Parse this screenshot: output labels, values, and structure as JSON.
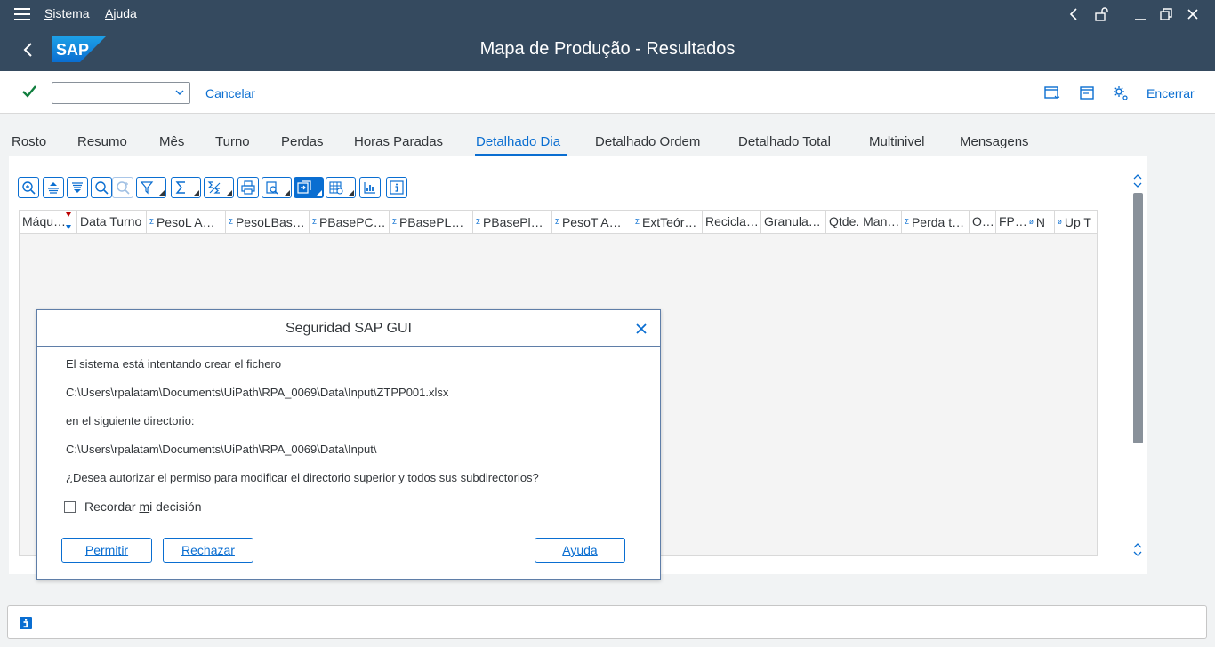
{
  "menubar": {
    "items": [
      {
        "label": "Sistema",
        "mnemonic": "S",
        "rest": "istema"
      },
      {
        "label": "Ajuda",
        "mnemonic": "A",
        "rest": "juda"
      }
    ]
  },
  "title": "Mapa de Produção - Resultados",
  "toolbar": {
    "command_field_value": "",
    "cancel_label": "Cancelar",
    "exit_label": "Encerrar"
  },
  "tabs": [
    {
      "label": "Rosto",
      "active": false
    },
    {
      "label": "Resumo",
      "active": false
    },
    {
      "label": "Mês",
      "active": false
    },
    {
      "label": "Turno",
      "active": false
    },
    {
      "label": "Perdas",
      "active": false
    },
    {
      "label": "Horas Paradas",
      "active": false
    },
    {
      "label": "Detalhado Dia",
      "active": true
    },
    {
      "label": "Detalhado Ordem",
      "active": false
    },
    {
      "label": "Detalhado Total",
      "active": false
    },
    {
      "label": "Multinivel",
      "active": false
    },
    {
      "label": "Mensagens",
      "active": false
    }
  ],
  "grid": {
    "columns": [
      {
        "label": "Máqu…",
        "agg": ""
      },
      {
        "label": "Data Turno",
        "agg": ""
      },
      {
        "label": "PesoL A…",
        "agg": "Σ"
      },
      {
        "label": "PesoLBas…",
        "agg": "Σ"
      },
      {
        "label": "PBasePC…",
        "agg": "Σ"
      },
      {
        "label": "PBasePL…",
        "agg": "Σ"
      },
      {
        "label": "PBasePl…",
        "agg": "Σ"
      },
      {
        "label": "PesoT A…",
        "agg": "Σ"
      },
      {
        "label": "ExtTeór…",
        "agg": "Σ"
      },
      {
        "label": "Recicla…",
        "agg": ""
      },
      {
        "label": "Granula…",
        "agg": ""
      },
      {
        "label": "Qtde. Man…",
        "agg": ""
      },
      {
        "label": "Perda t…",
        "agg": "Σ"
      },
      {
        "label": "O…",
        "agg": ""
      },
      {
        "label": "FP…",
        "agg": ""
      },
      {
        "label": "N",
        "agg": "ø"
      },
      {
        "label": "Up T",
        "agg": "ø"
      }
    ]
  },
  "dialog": {
    "title": "Seguridad SAP GUI",
    "line1": "El sistema está intentando crear el fichero",
    "line2": "C:\\Users\\rpalatam\\Documents\\UiPath\\RPA_0069\\Data\\Input\\ZTPP001.xlsx",
    "line3": "en el siguiente directorio:",
    "line4": "C:\\Users\\rpalatam\\Documents\\UiPath\\RPA_0069\\Data\\Input\\",
    "line5": "¿Desea autorizar el permiso para modificar el directorio superior y todos sus subdirectorios?",
    "remember": {
      "pre": "Recordar ",
      "mnemonic": "m",
      "post": "i decisión",
      "checked": false
    },
    "buttons": {
      "allow": "Permitir",
      "deny": "Rechazar",
      "help": "Ayuda"
    }
  },
  "statusbar": {
    "message": ""
  },
  "colors": {
    "shell": "#354a5f",
    "accent": "#0a6ed1",
    "background": "#f1f3f4"
  }
}
